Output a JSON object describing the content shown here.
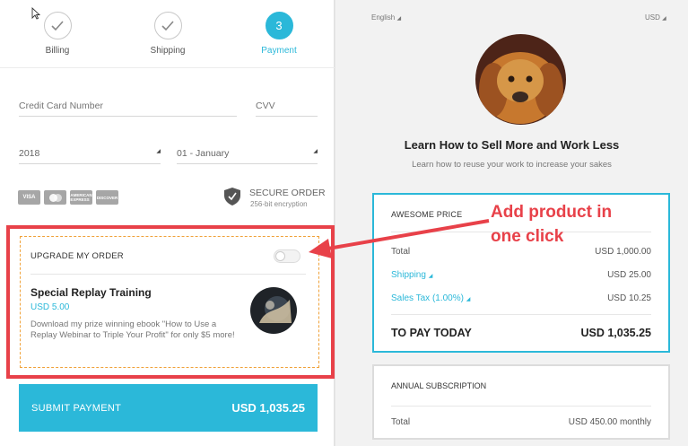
{
  "steps": [
    {
      "label": "Billing",
      "state": "done"
    },
    {
      "label": "Shipping",
      "state": "done"
    },
    {
      "label": "Payment",
      "number": "3",
      "state": "active"
    }
  ],
  "form": {
    "card_number_placeholder": "Credit Card Number",
    "cvv_placeholder": "CVV",
    "year_value": "2018",
    "month_value": "01 - January"
  },
  "card_logos": [
    "VISA",
    "MC",
    "AMEX",
    "DISC"
  ],
  "secure": {
    "title": "SECURE ORDER",
    "subtitle": "256-bit encryption"
  },
  "upgrade": {
    "title": "UPGRADE MY ORDER",
    "toggle_on": false,
    "product_name": "Special Replay Training",
    "product_price": "USD 5.00",
    "description": "Download my prize winning ebook \"How to Use a Replay Webinar to Triple Your Profit\" for only $5 more!"
  },
  "submit": {
    "label": "SUBMIT PAYMENT",
    "amount": "USD 1,035.25"
  },
  "header": {
    "language": "English",
    "currency": "USD"
  },
  "product": {
    "title": "Learn How to Sell More and Work Less",
    "subtitle": "Learn how to reuse your work to increase your sakes"
  },
  "pricing": {
    "heading": "AWESOME PRICE",
    "total_label": "Total",
    "total_value": "USD 1,000.00",
    "shipping_label": "Shipping",
    "shipping_value": "USD 25.00",
    "tax_label": "Sales Tax (1.00%)",
    "tax_value": "USD 10.25",
    "pay_label": "TO PAY TODAY",
    "pay_value": "USD 1,035.25"
  },
  "annual": {
    "heading": "ANNUAL SUBSCRIPTION",
    "total_label": "Total",
    "total_value": "USD 450.00 monthly"
  },
  "annotation": {
    "line1": "Add product in",
    "line2": "one click"
  },
  "colors": {
    "accent": "#2bb8d9",
    "annotation_red": "#e84149",
    "dashed_orange": "#f0a23a"
  }
}
